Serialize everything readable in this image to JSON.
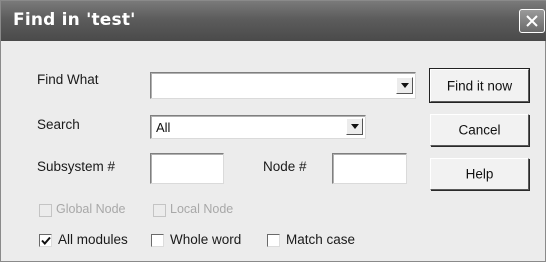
{
  "window": {
    "title": "Find in 'test'"
  },
  "form": {
    "find_what_label": "Find What",
    "find_what_value": "",
    "search_label": "Search",
    "search_value": "All",
    "subsystem_label": "Subsystem #",
    "subsystem_value": "",
    "node_label": "Node #",
    "node_value": ""
  },
  "buttons": {
    "find_now": "Find it now",
    "cancel": "Cancel",
    "help": "Help"
  },
  "options": {
    "global_node": {
      "label": "Global Node",
      "checked": false,
      "enabled": false
    },
    "local_node": {
      "label": "Local Node",
      "checked": false,
      "enabled": false
    },
    "all_modules": {
      "label": "All modules",
      "checked": true,
      "enabled": true
    },
    "whole_word": {
      "label": "Whole word",
      "checked": false,
      "enabled": true
    },
    "match_case": {
      "label": "Match case",
      "checked": false,
      "enabled": true
    }
  },
  "icons": {
    "close": "close-icon",
    "dropdown": "chevron-down-icon",
    "check": "checkmark-icon"
  },
  "colors": {
    "titlebar": "#5c5c5c",
    "dialog_background": "#ececec",
    "disabled_text": "#a8a8a8"
  }
}
